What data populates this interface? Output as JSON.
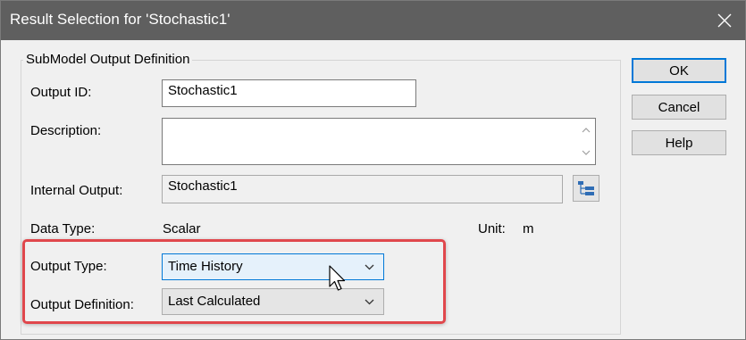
{
  "window": {
    "title": "Result Selection for 'Stochastic1'"
  },
  "group": {
    "legend": "SubModel Output Definition"
  },
  "output_id": {
    "label": "Output ID:",
    "value": "Stochastic1"
  },
  "description": {
    "label": "Description:",
    "value": ""
  },
  "internal_output": {
    "label": "Internal Output:",
    "value": "Stochastic1"
  },
  "data_type": {
    "label": "Data Type:",
    "value": "Scalar"
  },
  "unit": {
    "label": "Unit:",
    "value": "m"
  },
  "output_type": {
    "label": "Output Type:",
    "selected": "Time History"
  },
  "output_definition": {
    "label": "Output Definition:",
    "selected": "Last Calculated"
  },
  "buttons": {
    "ok": "OK",
    "cancel": "Cancel",
    "help": "Help"
  },
  "icons": {
    "close": "close-icon",
    "browse": "tree-browse-icon",
    "cursor": "mouse-pointer-icon"
  },
  "colors": {
    "titlebar": "#5f5f5f",
    "highlight": "#e0474c",
    "accent": "#0078d7"
  }
}
